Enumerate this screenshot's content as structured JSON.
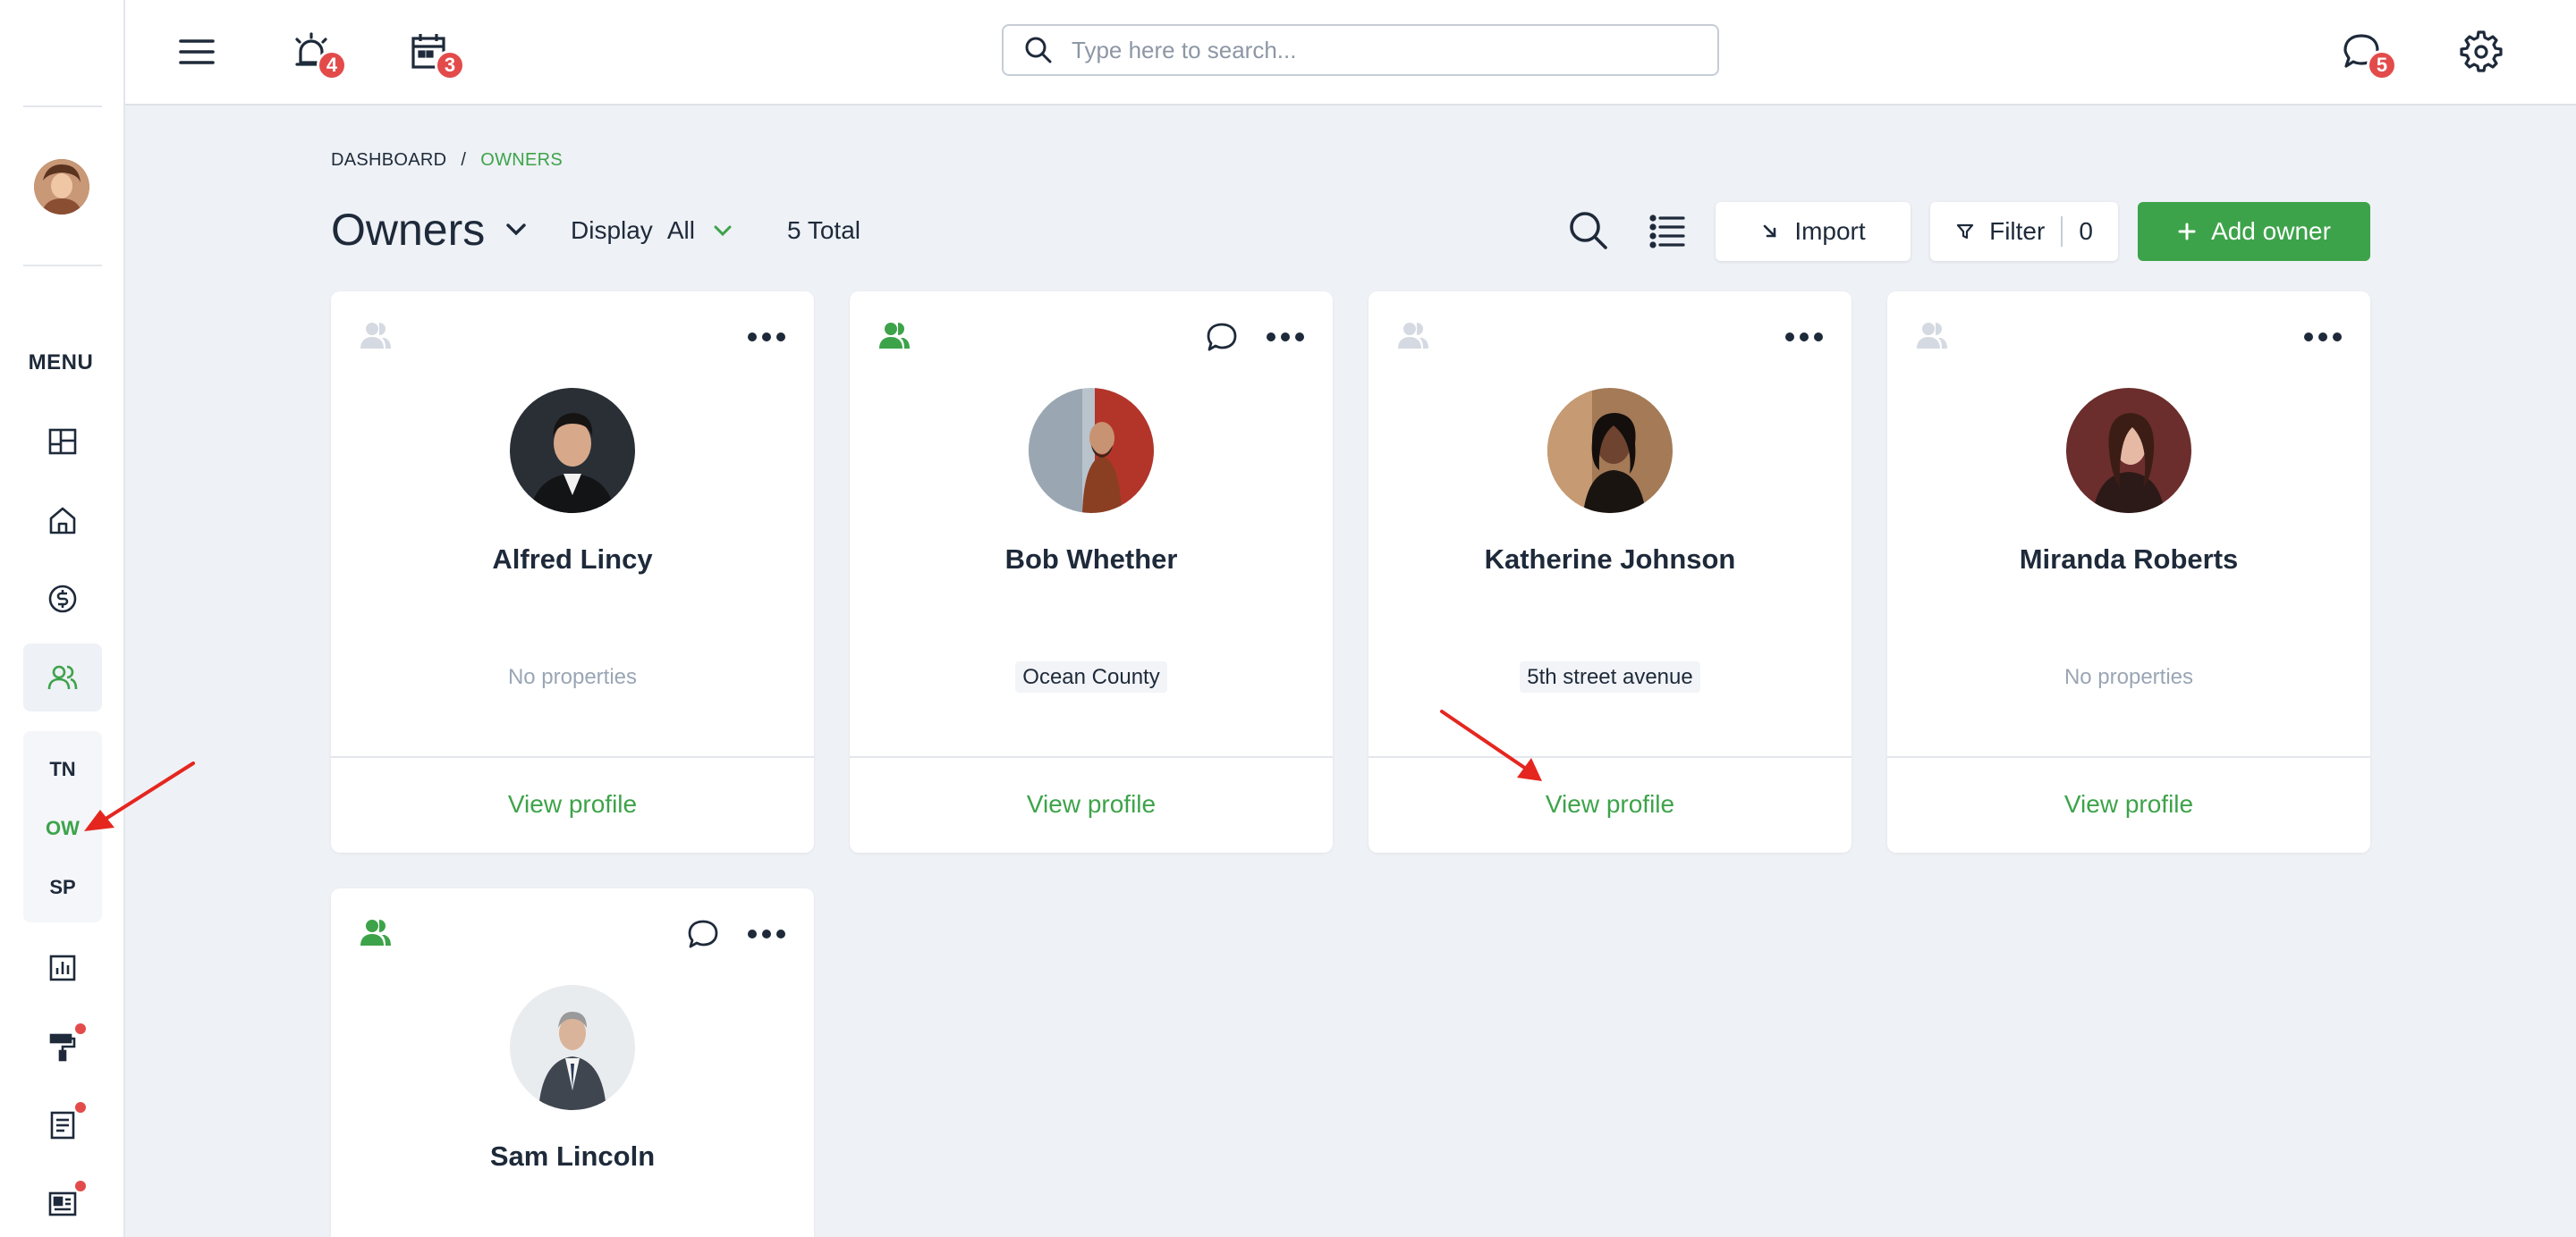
{
  "sidebar": {
    "menu_title": "MENU",
    "subnav": [
      "TN",
      "OW",
      "SP"
    ]
  },
  "topbar": {
    "notifications_badge": "4",
    "calendar_badge": "3",
    "search_placeholder": "Type here to search...",
    "messages_badge": "5"
  },
  "breadcrumb": {
    "root": "DASHBOARD",
    "separator": "/",
    "current": "OWNERS"
  },
  "header": {
    "title": "Owners",
    "display_label": "Display",
    "display_value": "All",
    "total": "5 Total",
    "import_label": "Import",
    "filter_label": "Filter",
    "filter_count": "0",
    "add_label": "Add owner"
  },
  "owners": [
    {
      "name": "Alfred Lincy",
      "properties": "No properties",
      "view": "View profile"
    },
    {
      "name": "Bob Whether",
      "properties": "Ocean County",
      "view": "View profile"
    },
    {
      "name": "Katherine Johnson",
      "properties": "5th street avenue",
      "view": "View profile"
    },
    {
      "name": "Miranda Roberts",
      "properties": "No properties",
      "view": "View profile"
    },
    {
      "name": "Sam Lincoln"
    }
  ],
  "colors": {
    "accent": "#3da34a",
    "badge": "#e34b4b",
    "text": "#1e2a3a",
    "background": "#eef1f5"
  }
}
